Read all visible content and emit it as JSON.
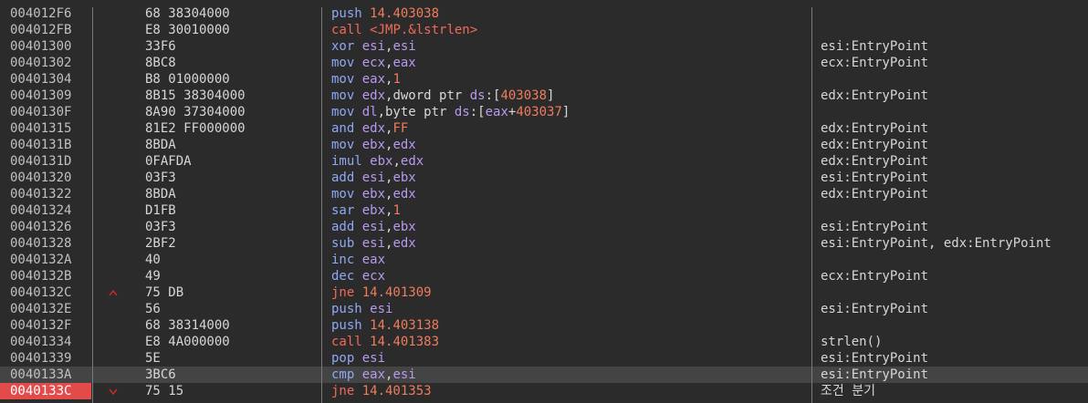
{
  "rows": [
    {
      "addr": "004012F6",
      "arrow": "",
      "bytes": "68 38304000",
      "ins": [
        [
          "mn",
          "push "
        ],
        [
          "imm",
          "14.403038"
        ]
      ],
      "comment": ""
    },
    {
      "addr": "004012FB",
      "arrow": "",
      "bytes": "E8 30010000",
      "ins": [
        [
          "mn-call",
          "call "
        ],
        [
          "mn-call",
          "<JMP.&lstrlen>"
        ]
      ],
      "comment": ""
    },
    {
      "addr": "00401300",
      "arrow": "",
      "bytes": "33F6",
      "ins": [
        [
          "mn",
          "xor "
        ],
        [
          "reg",
          "esi"
        ],
        [
          "plain",
          ","
        ],
        [
          "reg",
          "esi"
        ]
      ],
      "comment": "esi:EntryPoint"
    },
    {
      "addr": "00401302",
      "arrow": "",
      "bytes": "8BC8",
      "ins": [
        [
          "mn",
          "mov "
        ],
        [
          "reg",
          "ecx"
        ],
        [
          "plain",
          ","
        ],
        [
          "reg",
          "eax"
        ]
      ],
      "comment": "ecx:EntryPoint"
    },
    {
      "addr": "00401304",
      "arrow": "",
      "bytes": "B8 01000000",
      "ins": [
        [
          "mn",
          "mov "
        ],
        [
          "reg",
          "eax"
        ],
        [
          "plain",
          ","
        ],
        [
          "imm",
          "1"
        ]
      ],
      "comment": ""
    },
    {
      "addr": "00401309",
      "arrow": "",
      "bytes": "8B15 38304000",
      "ins": [
        [
          "mn",
          "mov "
        ],
        [
          "reg",
          "edx"
        ],
        [
          "plain",
          ",dword ptr "
        ],
        [
          "seg",
          "ds"
        ],
        [
          "plain",
          ":["
        ],
        [
          "imm",
          "403038"
        ],
        [
          "plain",
          "]"
        ]
      ],
      "comment": "edx:EntryPoint"
    },
    {
      "addr": "0040130F",
      "arrow": "",
      "bytes": "8A90 37304000",
      "ins": [
        [
          "mn",
          "mov "
        ],
        [
          "reg",
          "dl"
        ],
        [
          "plain",
          ",byte ptr "
        ],
        [
          "seg",
          "ds"
        ],
        [
          "plain",
          ":["
        ],
        [
          "reg",
          "eax"
        ],
        [
          "plain",
          "+"
        ],
        [
          "imm",
          "403037"
        ],
        [
          "plain",
          "]"
        ]
      ],
      "comment": ""
    },
    {
      "addr": "00401315",
      "arrow": "",
      "bytes": "81E2 FF000000",
      "ins": [
        [
          "mn",
          "and "
        ],
        [
          "reg",
          "edx"
        ],
        [
          "plain",
          ","
        ],
        [
          "imm",
          "FF"
        ]
      ],
      "comment": "edx:EntryPoint"
    },
    {
      "addr": "0040131B",
      "arrow": "",
      "bytes": "8BDA",
      "ins": [
        [
          "mn",
          "mov "
        ],
        [
          "reg",
          "ebx"
        ],
        [
          "plain",
          ","
        ],
        [
          "reg",
          "edx"
        ]
      ],
      "comment": "edx:EntryPoint"
    },
    {
      "addr": "0040131D",
      "arrow": "",
      "bytes": "0FAFDA",
      "ins": [
        [
          "mn",
          "imul "
        ],
        [
          "reg",
          "ebx"
        ],
        [
          "plain",
          ","
        ],
        [
          "reg",
          "edx"
        ]
      ],
      "comment": "edx:EntryPoint"
    },
    {
      "addr": "00401320",
      "arrow": "",
      "bytes": "03F3",
      "ins": [
        [
          "mn",
          "add "
        ],
        [
          "reg",
          "esi"
        ],
        [
          "plain",
          ","
        ],
        [
          "reg",
          "ebx"
        ]
      ],
      "comment": "esi:EntryPoint"
    },
    {
      "addr": "00401322",
      "arrow": "",
      "bytes": "8BDA",
      "ins": [
        [
          "mn",
          "mov "
        ],
        [
          "reg",
          "ebx"
        ],
        [
          "plain",
          ","
        ],
        [
          "reg",
          "edx"
        ]
      ],
      "comment": "edx:EntryPoint"
    },
    {
      "addr": "00401324",
      "arrow": "",
      "bytes": "D1FB",
      "ins": [
        [
          "mn",
          "sar "
        ],
        [
          "reg",
          "ebx"
        ],
        [
          "plain",
          ","
        ],
        [
          "imm",
          "1"
        ]
      ],
      "comment": ""
    },
    {
      "addr": "00401326",
      "arrow": "",
      "bytes": "03F3",
      "ins": [
        [
          "mn",
          "add "
        ],
        [
          "reg",
          "esi"
        ],
        [
          "plain",
          ","
        ],
        [
          "reg",
          "ebx"
        ]
      ],
      "comment": "esi:EntryPoint"
    },
    {
      "addr": "00401328",
      "arrow": "",
      "bytes": "2BF2",
      "ins": [
        [
          "mn",
          "sub "
        ],
        [
          "reg",
          "esi"
        ],
        [
          "plain",
          ","
        ],
        [
          "reg",
          "edx"
        ]
      ],
      "comment": "esi:EntryPoint, edx:EntryPoint"
    },
    {
      "addr": "0040132A",
      "arrow": "",
      "bytes": "40",
      "ins": [
        [
          "mn",
          "inc "
        ],
        [
          "reg",
          "eax"
        ]
      ],
      "comment": ""
    },
    {
      "addr": "0040132B",
      "arrow": "",
      "bytes": "49",
      "ins": [
        [
          "mn",
          "dec "
        ],
        [
          "reg",
          "ecx"
        ]
      ],
      "comment": "ecx:EntryPoint"
    },
    {
      "addr": "0040132C",
      "arrow": "^",
      "bytes": "75 DB",
      "ins": [
        [
          "mn-jcc",
          "jne "
        ],
        [
          "imm",
          "14.401309"
        ]
      ],
      "comment": ""
    },
    {
      "addr": "0040132E",
      "arrow": "",
      "bytes": "56",
      "ins": [
        [
          "mn",
          "push "
        ],
        [
          "reg",
          "esi"
        ]
      ],
      "comment": "esi:EntryPoint"
    },
    {
      "addr": "0040132F",
      "arrow": "",
      "bytes": "68 38314000",
      "ins": [
        [
          "mn",
          "push "
        ],
        [
          "imm",
          "14.403138"
        ]
      ],
      "comment": ""
    },
    {
      "addr": "00401334",
      "arrow": "",
      "bytes": "E8 4A000000",
      "ins": [
        [
          "mn-call",
          "call "
        ],
        [
          "imm",
          "14.401383"
        ]
      ],
      "comment": "strlen()"
    },
    {
      "addr": "00401339",
      "arrow": "",
      "bytes": "5E",
      "ins": [
        [
          "mn",
          "pop "
        ],
        [
          "reg",
          "esi"
        ]
      ],
      "comment": "esi:EntryPoint"
    },
    {
      "addr": "0040133A",
      "arrow": "",
      "bytes": "3BC6",
      "ins": [
        [
          "mn",
          "cmp "
        ],
        [
          "reg",
          "eax"
        ],
        [
          "plain",
          ","
        ],
        [
          "reg",
          "esi"
        ]
      ],
      "comment": "esi:EntryPoint",
      "highlight": true
    },
    {
      "addr": "0040133C",
      "arrow": "v",
      "bytes": "75 15",
      "ins": [
        [
          "mn-jcc",
          "jne "
        ],
        [
          "imm",
          "14.401353"
        ]
      ],
      "comment": "조건 분기",
      "eip": true
    }
  ],
  "colors": {
    "background": "#2b2b2b",
    "eip_address": "#e34b4b",
    "mnemonic": "#8fa8f6",
    "call_jump": "#f06a5a",
    "register": "#b89af0",
    "immediate": "#f07c5c",
    "jump_arrow": "#c82828"
  }
}
